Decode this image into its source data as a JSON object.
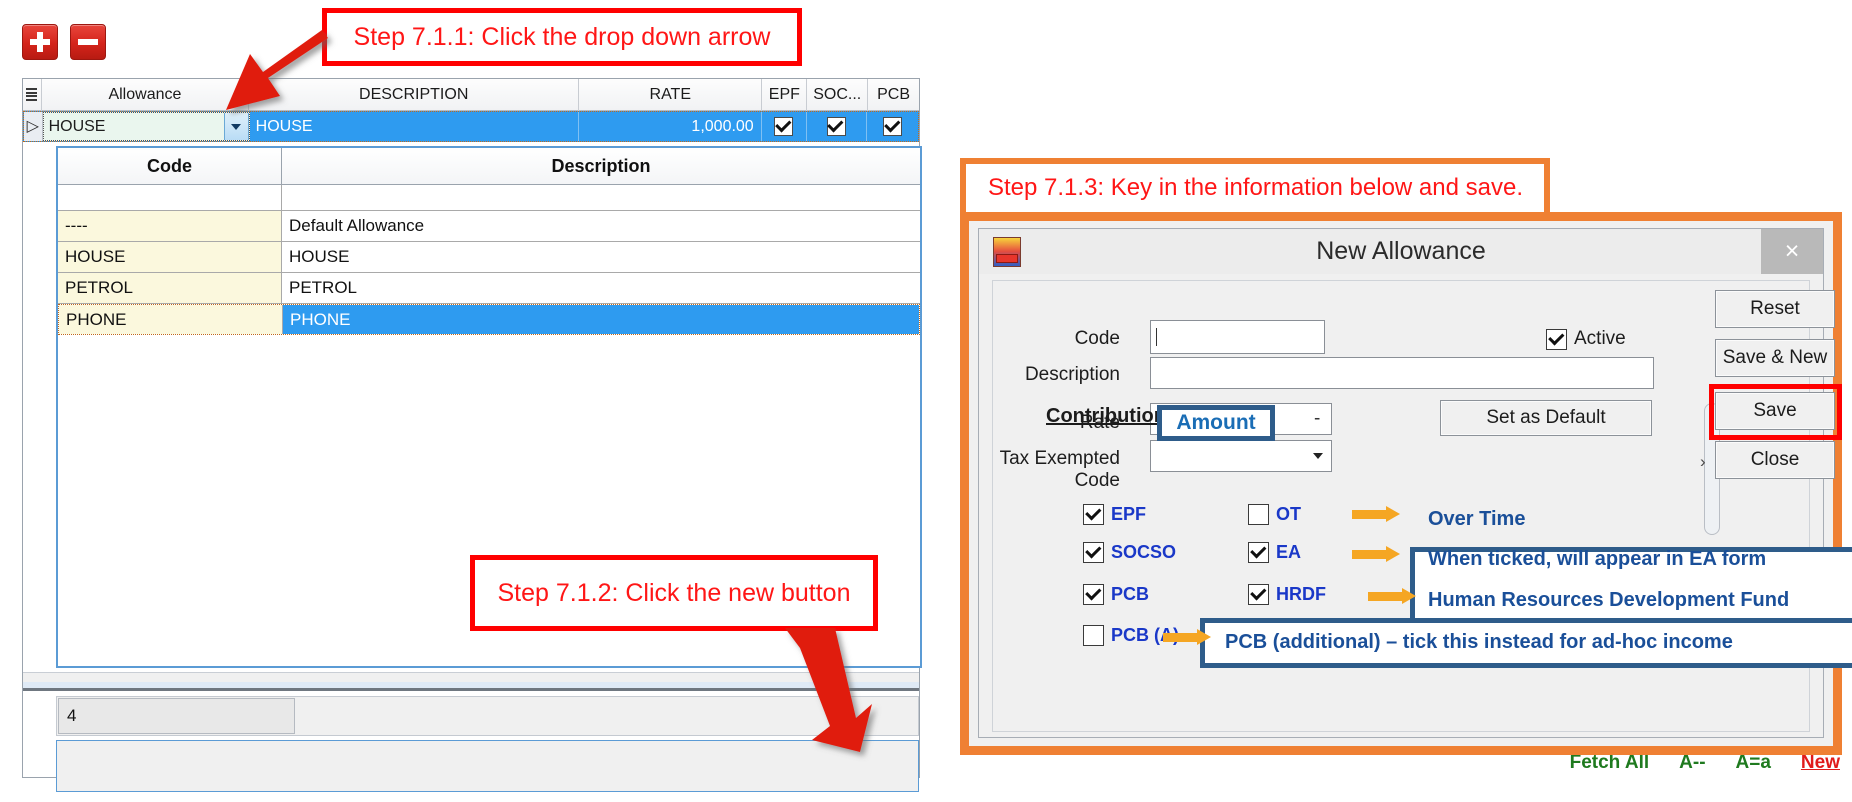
{
  "toolbar": {
    "add_label": "+",
    "remove_label": "-"
  },
  "grid": {
    "columns": [
      "Allowance",
      "DESCRIPTION",
      "RATE",
      "EPF",
      "SOC...",
      "PCB"
    ],
    "row": {
      "allowance": "HOUSE",
      "description": "HOUSE",
      "rate": "1,000.00",
      "epf_checked": true,
      "socso_checked": true,
      "pcb_checked": true
    },
    "record_count": "4"
  },
  "dropdown": {
    "columns": [
      "Code",
      "Description"
    ],
    "rows": [
      {
        "code": "----",
        "description": "Default Allowance",
        "selected": false
      },
      {
        "code": "HOUSE",
        "description": "HOUSE",
        "selected": false
      },
      {
        "code": "PETROL",
        "description": "PETROL",
        "selected": false
      },
      {
        "code": "PHONE",
        "description": "PHONE",
        "selected": true
      }
    ]
  },
  "footer": {
    "fetch_all": "Fetch All",
    "sort_desc": "A--",
    "sort_asc": "A=a",
    "new": "New"
  },
  "callouts": {
    "step_711": "Step 7.1.1: Click the drop down arrow",
    "step_712": "Step 7.1.2: Click the new button",
    "step_713": "Step 7.1.3: Key in the information below and save."
  },
  "dialog": {
    "title": "New Allowance",
    "close_label": "×",
    "fields": {
      "code_label": "Code",
      "code_value": "",
      "description_label": "Description",
      "description_value": "",
      "rate_label": "Rate",
      "rate_value": "",
      "rate_separator": "-",
      "tax_exempted_label": "Tax Exempted Code",
      "tax_exempted_value": "",
      "active_label": "Active",
      "active_checked": true,
      "set_as_default_label": "Set as Default"
    },
    "buttons": {
      "reset": "Reset",
      "save_and_new": "Save & New",
      "save": "Save",
      "close": "Close"
    },
    "contribution": {
      "title": "Contribution",
      "items": [
        {
          "label": "EPF",
          "checked": true,
          "column": 1
        },
        {
          "label": "SOCSO",
          "checked": true,
          "column": 1
        },
        {
          "label": "PCB",
          "checked": true,
          "column": 1
        },
        {
          "label": "PCB (A)",
          "checked": false,
          "column": 1
        },
        {
          "label": "OT",
          "checked": false,
          "column": 2
        },
        {
          "label": "EA",
          "checked": true,
          "column": 2
        },
        {
          "label": "HRDF",
          "checked": true,
          "column": 2
        }
      ]
    }
  },
  "annotations": {
    "amount": "Amount",
    "ot_note": "Over Time",
    "ea_note": "When ticked, will appear in EA form",
    "hrdf_note": "Human Resources Development Fund",
    "pcba_note": "PCB (additional) – tick this instead for ad-hoc income"
  },
  "colors": {
    "red_callout": "#ff0000",
    "orange_callout": "#ef8033",
    "blue_annotation": "#1a4f99",
    "grid_selection": "#2e9bf0",
    "orange_arrow": "#f5a623",
    "footer_link_green": "#1f7a1f",
    "footer_link_new": "#e01b1b"
  }
}
